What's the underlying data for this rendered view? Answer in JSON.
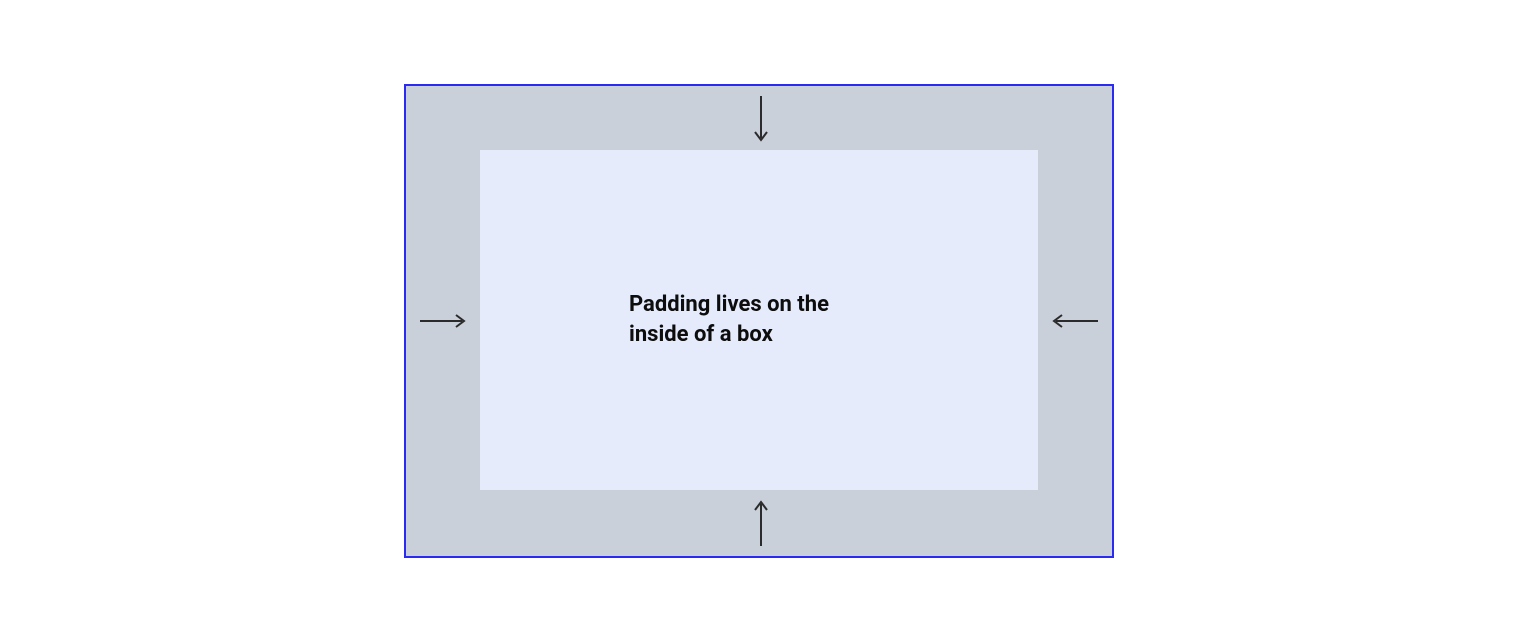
{
  "diagram": {
    "caption": "Padding lives on the inside of a box",
    "outer_border_color": "#2a2af0",
    "outer_fill_color": "#cad0da",
    "inner_fill_color": "#e5ebfb",
    "arrow_color": "#2b2b2b",
    "arrows": {
      "top": "arrow-down-icon",
      "bottom": "arrow-up-icon",
      "left": "arrow-right-icon",
      "right": "arrow-left-icon"
    }
  }
}
